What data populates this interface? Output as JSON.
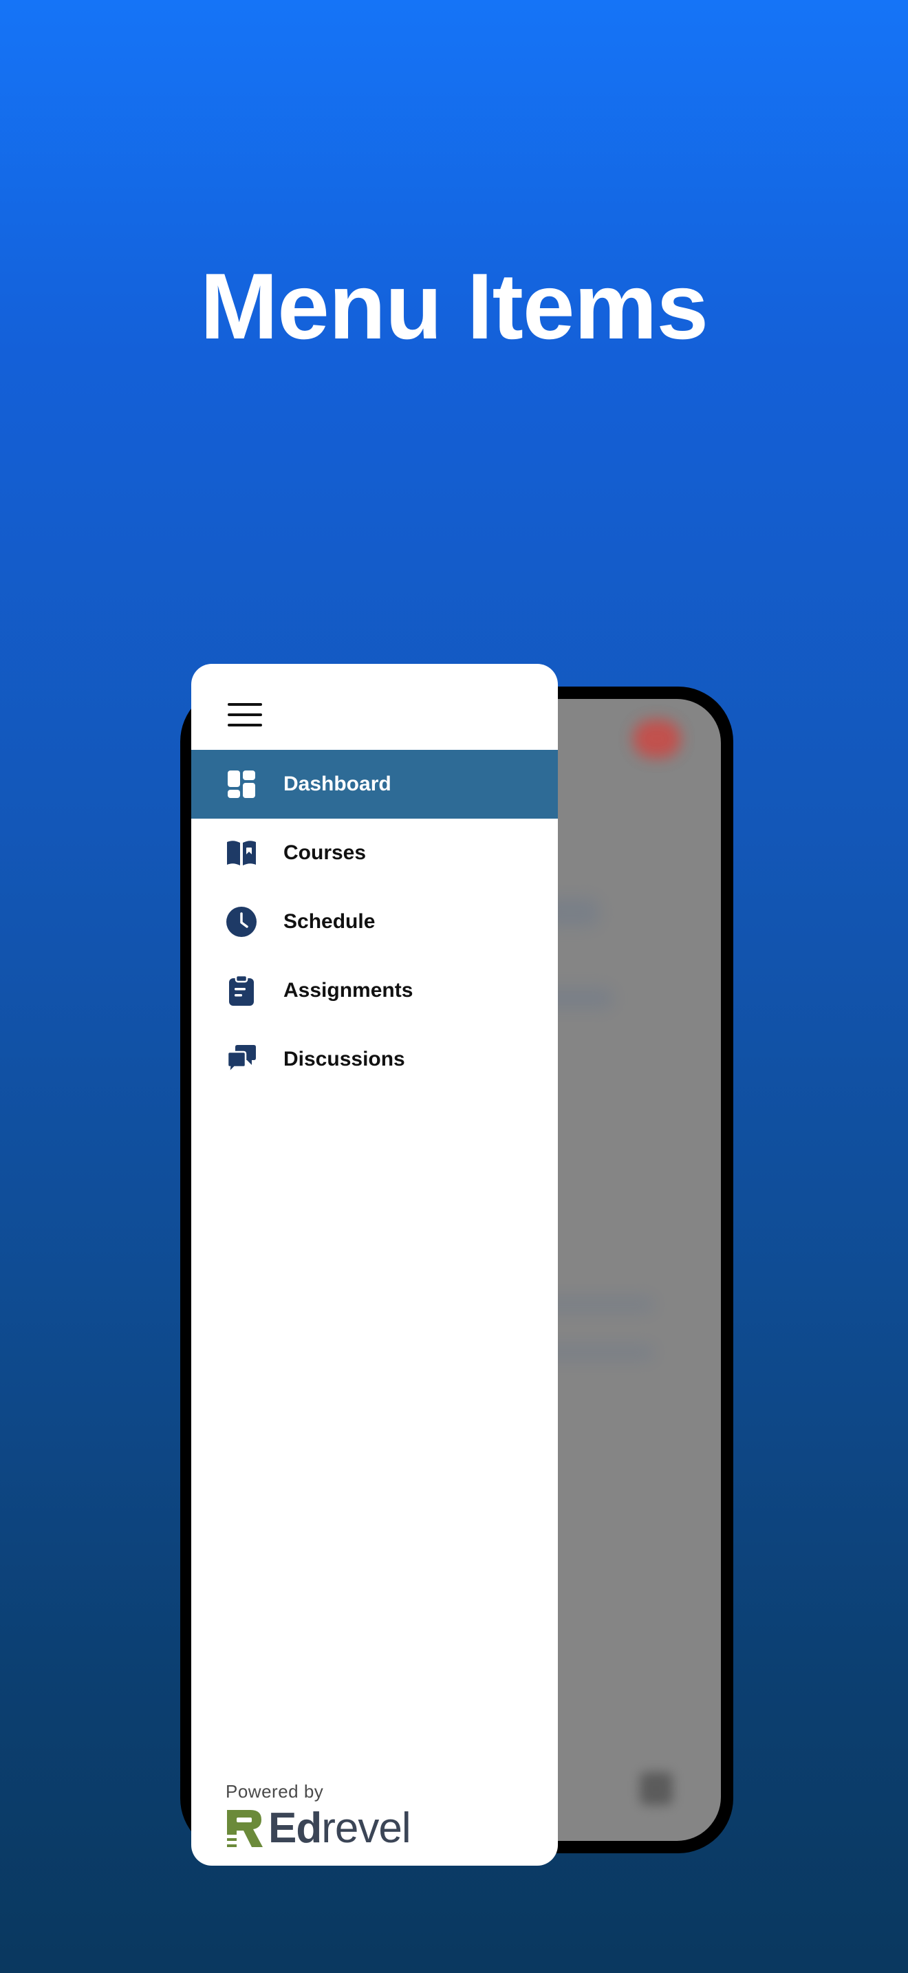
{
  "headline": "Menu Items",
  "drawer": {
    "menu_items": [
      {
        "label": "Dashboard",
        "icon": "dashboard-icon",
        "active": true
      },
      {
        "label": "Courses",
        "icon": "book-icon",
        "active": false
      },
      {
        "label": "Schedule",
        "icon": "clock-icon",
        "active": false
      },
      {
        "label": "Assignments",
        "icon": "clipboard-icon",
        "active": false
      },
      {
        "label": "Discussions",
        "icon": "chat-bubbles-icon",
        "active": false
      }
    ],
    "footer": {
      "powered_by": "Powered by",
      "brand_bold": "Ed",
      "brand_regular": "revel"
    }
  },
  "colors": {
    "active_item": "#2e6b96",
    "icon": "#1e3a66",
    "brand_logo": "#6b8a3a",
    "brand_text": "#3b4556"
  }
}
